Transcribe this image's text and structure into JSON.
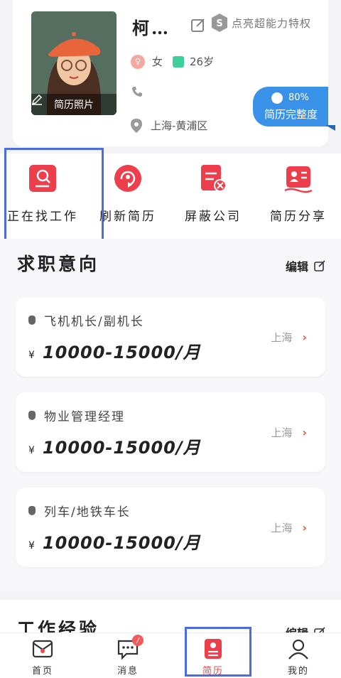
{
  "profile": {
    "name": "柯…",
    "photo_label": "简历照片",
    "badge_text": "点亮超能力特权",
    "gender": "女",
    "age": "26岁",
    "location": "上海-黄浦区",
    "completion_pct": "80%",
    "completion_label": "简历完整度"
  },
  "actions": [
    {
      "label": "正在找工作",
      "icon": "job-search-icon"
    },
    {
      "label": "刷新简历",
      "icon": "refresh-icon"
    },
    {
      "label": "屏蔽公司",
      "icon": "block-company-icon"
    },
    {
      "label": "简历分享",
      "icon": "share-resume-icon"
    }
  ],
  "intent": {
    "title": "求职意向",
    "edit_label": "编辑",
    "jobs": [
      {
        "title": "飞机机长/副机长",
        "salary": "10000-15000/月",
        "currency": "¥",
        "city": "上海"
      },
      {
        "title": "物业管理经理",
        "salary": "10000-15000/月",
        "currency": "¥",
        "city": "上海"
      },
      {
        "title": "列车/地铁车长",
        "salary": "10000-15000/月",
        "currency": "¥",
        "city": "上海"
      }
    ]
  },
  "work": {
    "title": "工作经验",
    "edit_label": "编辑"
  },
  "nav": [
    {
      "label": "首页",
      "icon": "home-icon"
    },
    {
      "label": "消息",
      "icon": "message-icon",
      "badge": "/"
    },
    {
      "label": "简历",
      "icon": "resume-icon"
    },
    {
      "label": "我的",
      "icon": "profile-icon"
    }
  ],
  "colors": {
    "accent": "#e84a4a",
    "completion": "#3a92e8",
    "highlight": "#4c6be0"
  }
}
